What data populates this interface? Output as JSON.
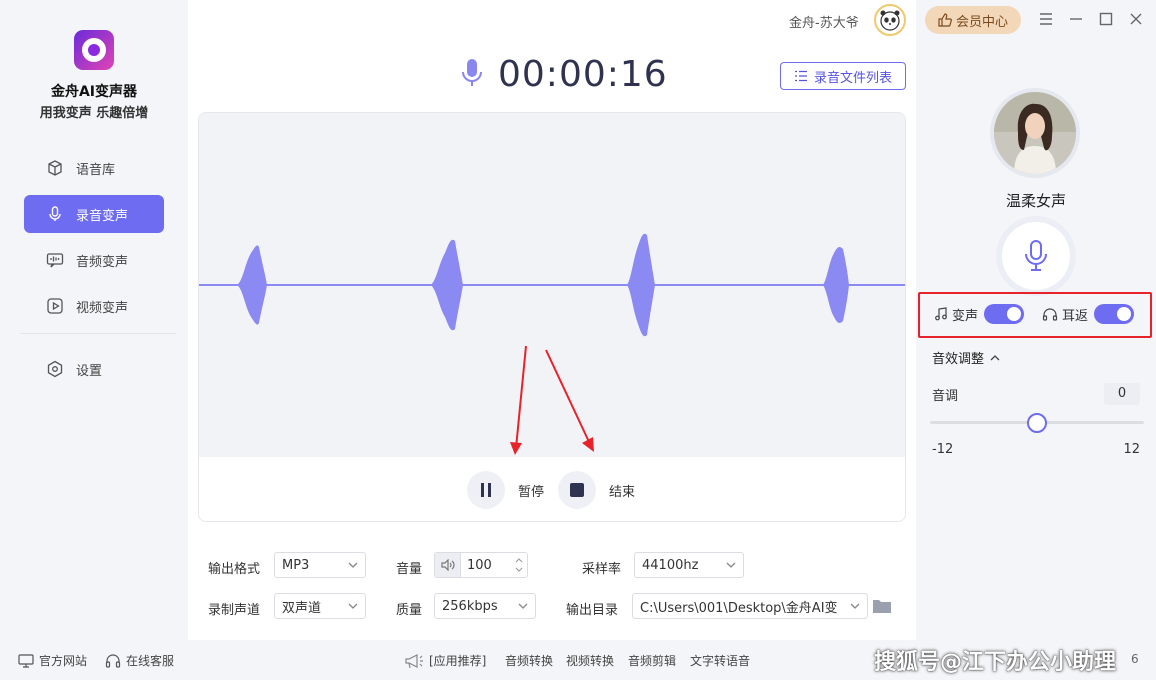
{
  "app": {
    "name": "金舟AI变声器",
    "slogan": "用我变声 乐趣倍增"
  },
  "sidebar": {
    "items": [
      {
        "label": "语音库",
        "icon": "cube-icon"
      },
      {
        "label": "录音变声",
        "icon": "microphone-icon"
      },
      {
        "label": "音频变声",
        "icon": "audio-wave-icon"
      },
      {
        "label": "视频变声",
        "icon": "video-play-icon"
      },
      {
        "label": "设置",
        "icon": "settings-icon"
      }
    ],
    "active": "录音变声"
  },
  "topbar": {
    "user": "金舟-苏大爷",
    "vip_label": "会员中心"
  },
  "recorder": {
    "timer": "00:00:16",
    "list_button": "录音文件列表",
    "pause_label": "暂停",
    "stop_label": "结束"
  },
  "options": {
    "format_label": "输出格式",
    "format_value": "MP3",
    "volume_label": "音量",
    "volume_value": "100",
    "samplerate_label": "采样率",
    "samplerate_value": "44100hz",
    "channel_label": "录制声道",
    "channel_value": "双声道",
    "quality_label": "质量",
    "quality_value": "256kbps",
    "outdir_label": "输出目录",
    "outdir_value": "C:\\Users\\001\\Desktop\\金舟AI变"
  },
  "voice_panel": {
    "voice_name": "温柔女声",
    "toggle_voice_label": "变声",
    "toggle_voice_on": true,
    "toggle_monitor_label": "耳返",
    "toggle_monitor_on": true,
    "fx_title": "音效调整",
    "pitch_label": "音调",
    "pitch_value": "0",
    "pitch_min": "-12",
    "pitch_max": "12"
  },
  "footer": {
    "website": "官方网站",
    "support": "在线客服",
    "recommend": "[应用推荐]",
    "links": [
      "音频转换",
      "视频转换",
      "音频剪辑",
      "文字转语音"
    ],
    "watermark": "搜狐号@江下办公小助理",
    "version_fragment": "6"
  },
  "colors": {
    "accent": "#6e6cf0",
    "highlight_box": "#e8222a",
    "wave": "#8b8af2",
    "vip_bg": "#f2d7b8"
  }
}
